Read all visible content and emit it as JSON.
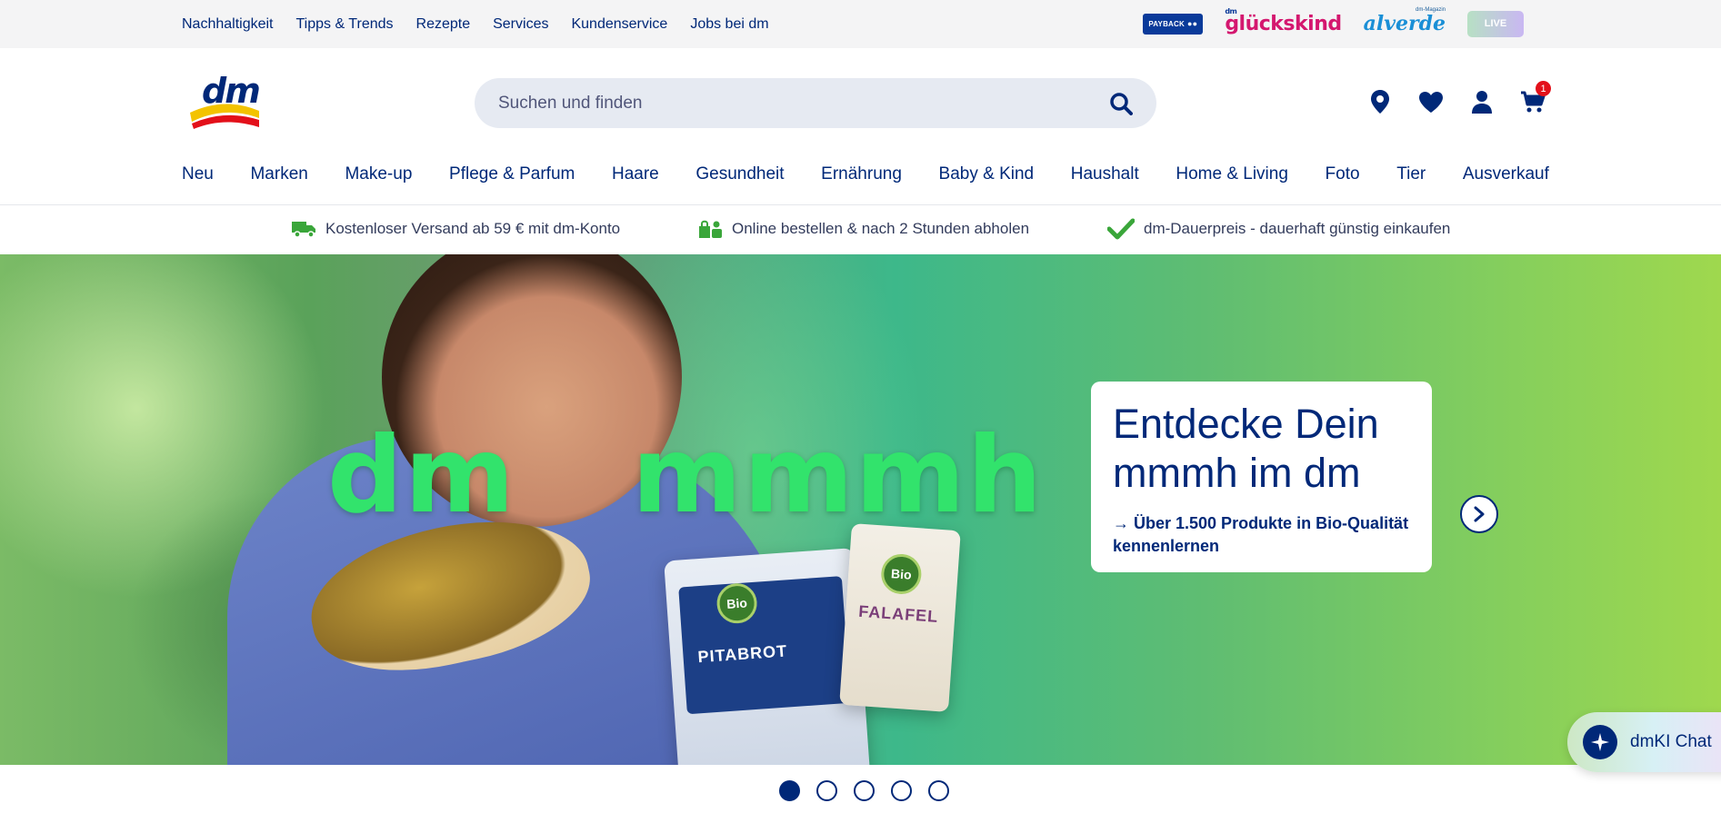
{
  "topbar": {
    "links": [
      "Nachhaltigkeit",
      "Tipps & Trends",
      "Rezepte",
      "Services",
      "Kundenservice",
      "Jobs bei dm"
    ],
    "partners": {
      "payback": "PAYBACK",
      "glueckskind_prefix": "dm",
      "glueckskind": "glückskind",
      "alverde_small": "dm-Magazin",
      "alverde": "alverde",
      "live": "LIVE"
    }
  },
  "header": {
    "logo": "dm",
    "search_placeholder": "Suchen und finden",
    "cart_count": "1"
  },
  "nav": [
    "Neu",
    "Marken",
    "Make-up",
    "Pflege & Parfum",
    "Haare",
    "Gesundheit",
    "Ernährung",
    "Baby & Kind",
    "Haushalt",
    "Home & Living",
    "Foto",
    "Tier",
    "Ausverkauf"
  ],
  "usp": [
    "Kostenloser Versand ab 59 € mit dm-Konto",
    "Online bestellen & nach 2 Stunden abholen",
    "dm-Dauerpreis - dauerhaft günstig einkaufen"
  ],
  "hero": {
    "headline": "dm   mmmh",
    "card_title": "Entdecke Dein mmmh im dm",
    "card_link": "→ Über 1.500 Produkte in Bio-Qualität kennenlernen",
    "product1_label": "PITABROT",
    "product2_label": "FALAFEL",
    "bio_label": "Bio"
  },
  "carousel": {
    "slide_count": 5,
    "active_index": 0
  },
  "chat": {
    "label": "dmKI Chat"
  },
  "colors": {
    "brand_blue": "#002878",
    "hero_green": "#32e36c",
    "badge_red": "#e3101a"
  }
}
